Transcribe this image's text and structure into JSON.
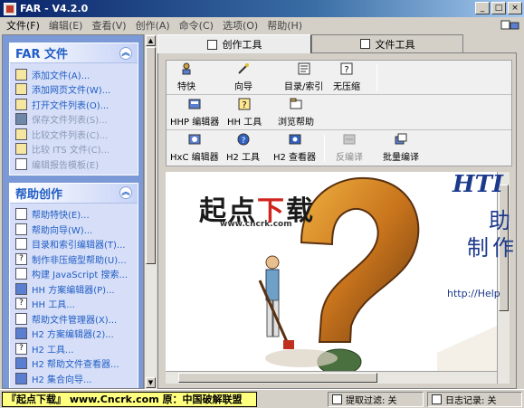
{
  "window": {
    "title": "FAR - V4.2.0"
  },
  "menu": [
    "文件(F)",
    "编辑(E)",
    "查看(V)",
    "创作(A)",
    "命令(C)",
    "选项(O)",
    "帮助(H)"
  ],
  "left": {
    "file_group": {
      "title": "FAR 文件",
      "items": [
        {
          "label": "添加文件(A)...",
          "enabled": true,
          "icon": "folder-open-icon"
        },
        {
          "label": "添加网页文件(W)...",
          "enabled": true,
          "icon": "folder-open-icon"
        },
        {
          "label": "打开文件列表(O)...",
          "enabled": true,
          "icon": "folder-open-icon"
        },
        {
          "label": "保存文件列表(S)...",
          "enabled": false,
          "icon": "save-disk-icon"
        },
        {
          "label": "比较文件列表(C)...",
          "enabled": false,
          "icon": "compare-folder-icon"
        },
        {
          "label": "比较 ITS 文件(C)...",
          "enabled": false,
          "icon": "compare-folder-icon"
        },
        {
          "label": "编辑报告模板(E)",
          "enabled": false,
          "icon": "report-template-icon"
        }
      ]
    },
    "help_group": {
      "title": "帮助创作",
      "items": [
        {
          "label": "帮助特快(E)...",
          "icon": "wizard-icon"
        },
        {
          "label": "帮助向导(W)...",
          "icon": "wand-icon"
        },
        {
          "label": "目录和索引编辑器(T)...",
          "icon": "toc-icon"
        },
        {
          "label": "制作非压缩型帮助(U)...",
          "icon": "help-doc-icon"
        },
        {
          "label": "构建 JavaScript 搜索...",
          "icon": "search-doc-icon"
        },
        {
          "label": "HH 方案编辑器(P)...",
          "icon": "hh-project-icon"
        },
        {
          "label": "HH 工具...",
          "icon": "hh-tools-icon"
        },
        {
          "label": "帮助文件管理器(X)...",
          "icon": "file-manager-icon"
        },
        {
          "label": "H2 方案编辑器(2)...",
          "icon": "h2-project-icon"
        },
        {
          "label": "H2 工具...",
          "icon": "h2-tools-icon"
        },
        {
          "label": "H2 帮助文件查看器...",
          "icon": "h2-viewer-icon"
        },
        {
          "label": "H2 集合向导...",
          "icon": "h2-collection-icon"
        }
      ]
    }
  },
  "tabs": [
    {
      "label": "创作工具",
      "active": true,
      "icon": "authoring-tools-icon"
    },
    {
      "label": "文件工具",
      "active": false,
      "icon": "file-tools-icon"
    }
  ],
  "toolbar": {
    "row1": [
      {
        "label": "特快",
        "icon": "express-icon",
        "enabled": true
      },
      {
        "label": "向导",
        "icon": "wizard-icon",
        "enabled": true
      },
      {
        "label": "目录/索引",
        "icon": "toc-index-icon",
        "enabled": true
      },
      {
        "label": "无压缩",
        "icon": "uncompressed-icon",
        "enabled": true
      }
    ],
    "row2": [
      {
        "label": "HHP 编辑器",
        "icon": "hhp-editor-icon",
        "enabled": true
      },
      {
        "label": "HH 工具",
        "icon": "hh-tools-icon",
        "enabled": true
      },
      {
        "label": "浏览帮助",
        "icon": "browse-help-icon",
        "enabled": true
      }
    ],
    "row3": [
      {
        "label": "HxC 编辑器",
        "icon": "hxc-editor-icon",
        "enabled": true
      },
      {
        "label": "H2 工具",
        "icon": "h2-tools-icon",
        "enabled": true
      },
      {
        "label": "H2 查看器",
        "icon": "h2-viewer-icon",
        "enabled": true
      },
      {
        "label": "反编译",
        "icon": "decompile-icon",
        "enabled": false
      },
      {
        "label": "批量编译",
        "icon": "batch-compile-icon",
        "enabled": true
      }
    ]
  },
  "art": {
    "heading": "HTI",
    "glyph1": "助",
    "glyph2": "制作",
    "url": "http://Help",
    "watermark_left": "起点",
    "watermark_mid": "下",
    "watermark_right": "载",
    "watermark_sub": "www.cncrk.com"
  },
  "status": {
    "banner": "『起点下载』 www.Cncrk.com 原：中国破解联盟",
    "filter": "提取过滤: 关",
    "log": "日志记录: 关"
  },
  "colors": {
    "title_bar": "#0a246a",
    "panel_bg": "#7b99d6",
    "link": "#215dc6",
    "banner_bg": "#ffff80"
  }
}
